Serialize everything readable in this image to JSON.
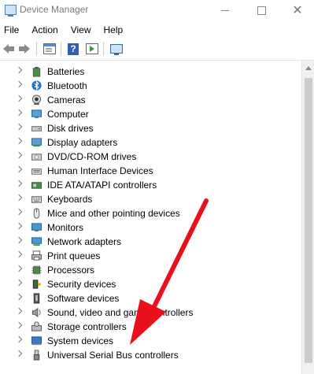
{
  "window": {
    "title": "Device Manager"
  },
  "menu": [
    "File",
    "Action",
    "View",
    "Help"
  ],
  "toolbar": {
    "icons": [
      "back-arrow-icon",
      "forward-arrow-icon",
      "properties-icon",
      "help-icon",
      "run-icon",
      "monitor-icon"
    ]
  },
  "tree": {
    "items": [
      {
        "label": "Batteries",
        "icon": "battery-icon"
      },
      {
        "label": "Bluetooth",
        "icon": "bluetooth-icon"
      },
      {
        "label": "Cameras",
        "icon": "camera-icon"
      },
      {
        "label": "Computer",
        "icon": "computer-icon"
      },
      {
        "label": "Disk drives",
        "icon": "disk-drive-icon"
      },
      {
        "label": "Display adapters",
        "icon": "display-adapter-icon"
      },
      {
        "label": "DVD/CD-ROM drives",
        "icon": "dvd-drive-icon"
      },
      {
        "label": "Human Interface Devices",
        "icon": "hid-icon"
      },
      {
        "label": "IDE ATA/ATAPI controllers",
        "icon": "ide-controller-icon"
      },
      {
        "label": "Keyboards",
        "icon": "keyboard-icon"
      },
      {
        "label": "Mice and other pointing devices",
        "icon": "mouse-icon"
      },
      {
        "label": "Monitors",
        "icon": "monitor-icon"
      },
      {
        "label": "Network adapters",
        "icon": "network-adapter-icon"
      },
      {
        "label": "Print queues",
        "icon": "printer-icon"
      },
      {
        "label": "Processors",
        "icon": "processor-icon"
      },
      {
        "label": "Security devices",
        "icon": "security-device-icon"
      },
      {
        "label": "Software devices",
        "icon": "software-device-icon"
      },
      {
        "label": "Sound, video and game controllers",
        "icon": "sound-icon"
      },
      {
        "label": "Storage controllers",
        "icon": "storage-controller-icon"
      },
      {
        "label": "System devices",
        "icon": "system-device-icon"
      },
      {
        "label": "Universal Serial Bus controllers",
        "icon": "usb-icon"
      }
    ]
  },
  "annotation": {
    "color": "#e8101a",
    "points_to": "Universal Serial Bus controllers"
  }
}
